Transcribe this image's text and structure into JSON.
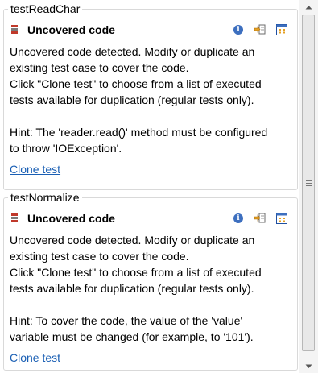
{
  "groups": [
    {
      "title": "testReadChar",
      "header": "Uncovered code",
      "icon": "uncovered-code-icon",
      "lines": [
        "Uncovered code detected. Modify or duplicate an",
        "existing test case to cover the code.",
        "Click \"Clone test\" to choose from a list of executed",
        "tests available for duplication (regular tests only)."
      ],
      "hint_lines": [
        "Hint: The 'reader.read()' method must be configured",
        "to throw 'IOException'."
      ],
      "link": "Clone test"
    },
    {
      "title": "testNormalize",
      "header": "Uncovered code",
      "icon": "uncovered-code-icon",
      "lines": [
        "Uncovered code detected. Modify or duplicate an",
        "existing test case to cover the code.",
        "Click \"Clone test\" to choose from a list of executed",
        "tests available for duplication (regular tests only)."
      ],
      "hint_lines": [
        "Hint: To cover the code, the value of the 'value'",
        "variable must be changed (for example, to '101')."
      ],
      "link": "Clone test"
    }
  ],
  "actions": {
    "info_icon": "info-icon",
    "info_glyph": "i",
    "go_to_icon": "go-to-source-icon",
    "details_icon": "show-details-icon"
  },
  "scrollbar": {
    "up_icon": "scroll-up-arrow-icon",
    "down_icon": "scroll-down-arrow-icon"
  },
  "colors": {
    "link": "#1a5fb4",
    "info": "#3d6fbf",
    "warning_red": "#c0392b",
    "border": "#d9d9d9"
  }
}
